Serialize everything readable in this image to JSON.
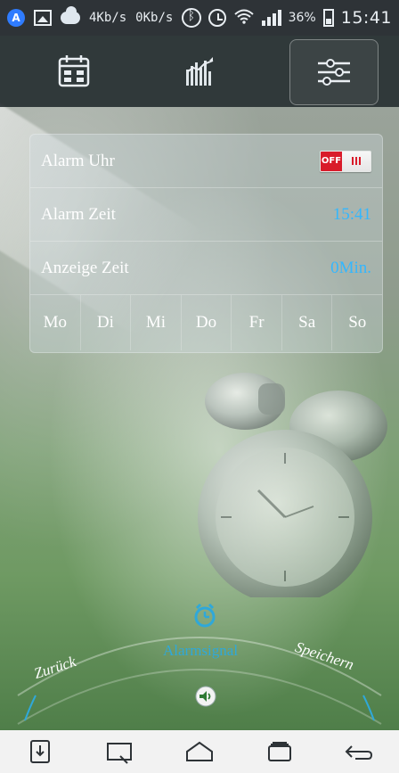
{
  "status_bar": {
    "net_down": "4Kb/s",
    "net_up": "0Kb/s",
    "battery": "36%",
    "time": "15:41"
  },
  "settings": {
    "alarm_clock": {
      "label": "Alarm Uhr",
      "toggle_state": "OFF"
    },
    "alarm_time": {
      "label": "Alarm Zeit",
      "value": "15:41"
    },
    "display_time": {
      "label": "Anzeige Zeit",
      "value": "0Min."
    },
    "days": [
      "Mo",
      "Di",
      "Mi",
      "Do",
      "Fr",
      "Sa",
      "So"
    ]
  },
  "bottom_menu": {
    "back_label": "Zurück",
    "signal_label": "Alarmsignal",
    "save_label": "Speichern"
  },
  "colors": {
    "accent_blue": "#33b7ff",
    "toggle_red": "#d91b2a"
  },
  "icons": {
    "top_tabs": [
      "calendar-icon",
      "stats-icon",
      "sliders-icon"
    ],
    "nav": [
      "download-icon",
      "recent-icon",
      "home-icon",
      "window-icon",
      "back-icon"
    ]
  }
}
